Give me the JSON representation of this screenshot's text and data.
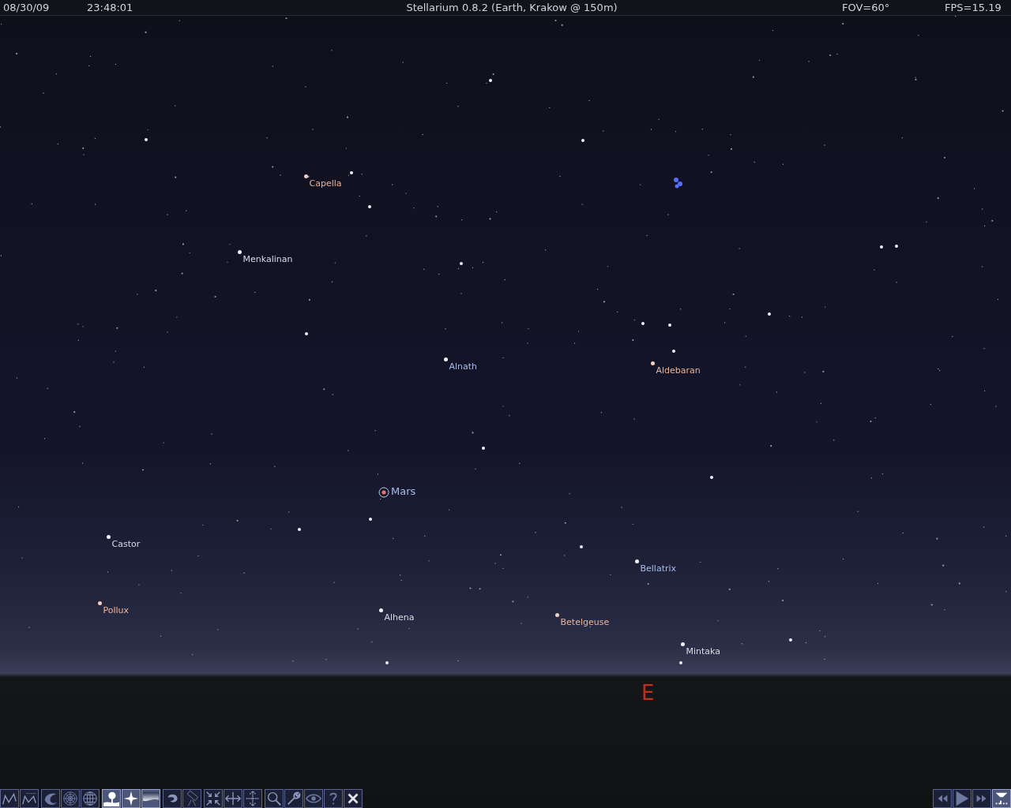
{
  "top_bar": {
    "date": "08/30/09",
    "time": "23:48:01",
    "title": "Stellarium 0.8.2 (Earth, Krakow @ 150m)",
    "fov": "FOV=60°",
    "fps": "FPS=15.19"
  },
  "objects": [
    {
      "kind": "star",
      "name": "Capella",
      "color": "#e8b39a"
    },
    {
      "kind": "star",
      "name": "Menkalinan",
      "color": "#d8dce8"
    },
    {
      "kind": "star",
      "name": "Alnath",
      "color": "#a9bce8"
    },
    {
      "kind": "star",
      "name": "Aldebaran",
      "color": "#e8b39a"
    },
    {
      "kind": "planet",
      "name": "Mars",
      "color": "#a9bce8"
    },
    {
      "kind": "star",
      "name": "Castor",
      "color": "#d8dce8"
    },
    {
      "kind": "star",
      "name": "Bellatrix",
      "color": "#a9bce8"
    },
    {
      "kind": "star",
      "name": "Pollux",
      "color": "#e8b39a"
    },
    {
      "kind": "star",
      "name": "Alhena",
      "color": "#d8dce8"
    },
    {
      "kind": "star",
      "name": "Betelgeuse",
      "color": "#e8b39a"
    },
    {
      "kind": "star",
      "name": "Mintaka",
      "color": "#d8dce8"
    }
  ],
  "cardinal": "E",
  "toolbar": {
    "groups": [
      [
        {
          "kind": "lines",
          "selected": false
        },
        {
          "kind": "labels",
          "selected": false
        }
      ],
      [
        {
          "kind": "art",
          "selected": false
        },
        {
          "kind": "eq-grid",
          "selected": false
        },
        {
          "kind": "az-grid",
          "selected": false
        }
      ],
      [
        {
          "kind": "ground",
          "selected": true
        },
        {
          "kind": "compass",
          "selected": true
        },
        {
          "kind": "atmosphere",
          "selected": true
        }
      ],
      [
        {
          "kind": "nebula",
          "selected": false
        },
        {
          "kind": "mount",
          "selected": false
        }
      ],
      [
        {
          "kind": "center",
          "selected": false
        },
        {
          "kind": "flip-h",
          "selected": false
        },
        {
          "kind": "flip-v",
          "selected": false
        }
      ],
      [
        {
          "kind": "search",
          "selected": false
        },
        {
          "kind": "wrench",
          "selected": false
        },
        {
          "kind": "eye",
          "selected": false
        },
        {
          "kind": "help",
          "selected": false
        },
        {
          "kind": "close",
          "selected": false
        }
      ]
    ],
    "time_controls": [
      {
        "kind": "rewind",
        "selected": false
      },
      {
        "kind": "play",
        "selected": false
      },
      {
        "kind": "forward",
        "selected": false
      },
      {
        "kind": "filter",
        "selected": true
      }
    ]
  }
}
